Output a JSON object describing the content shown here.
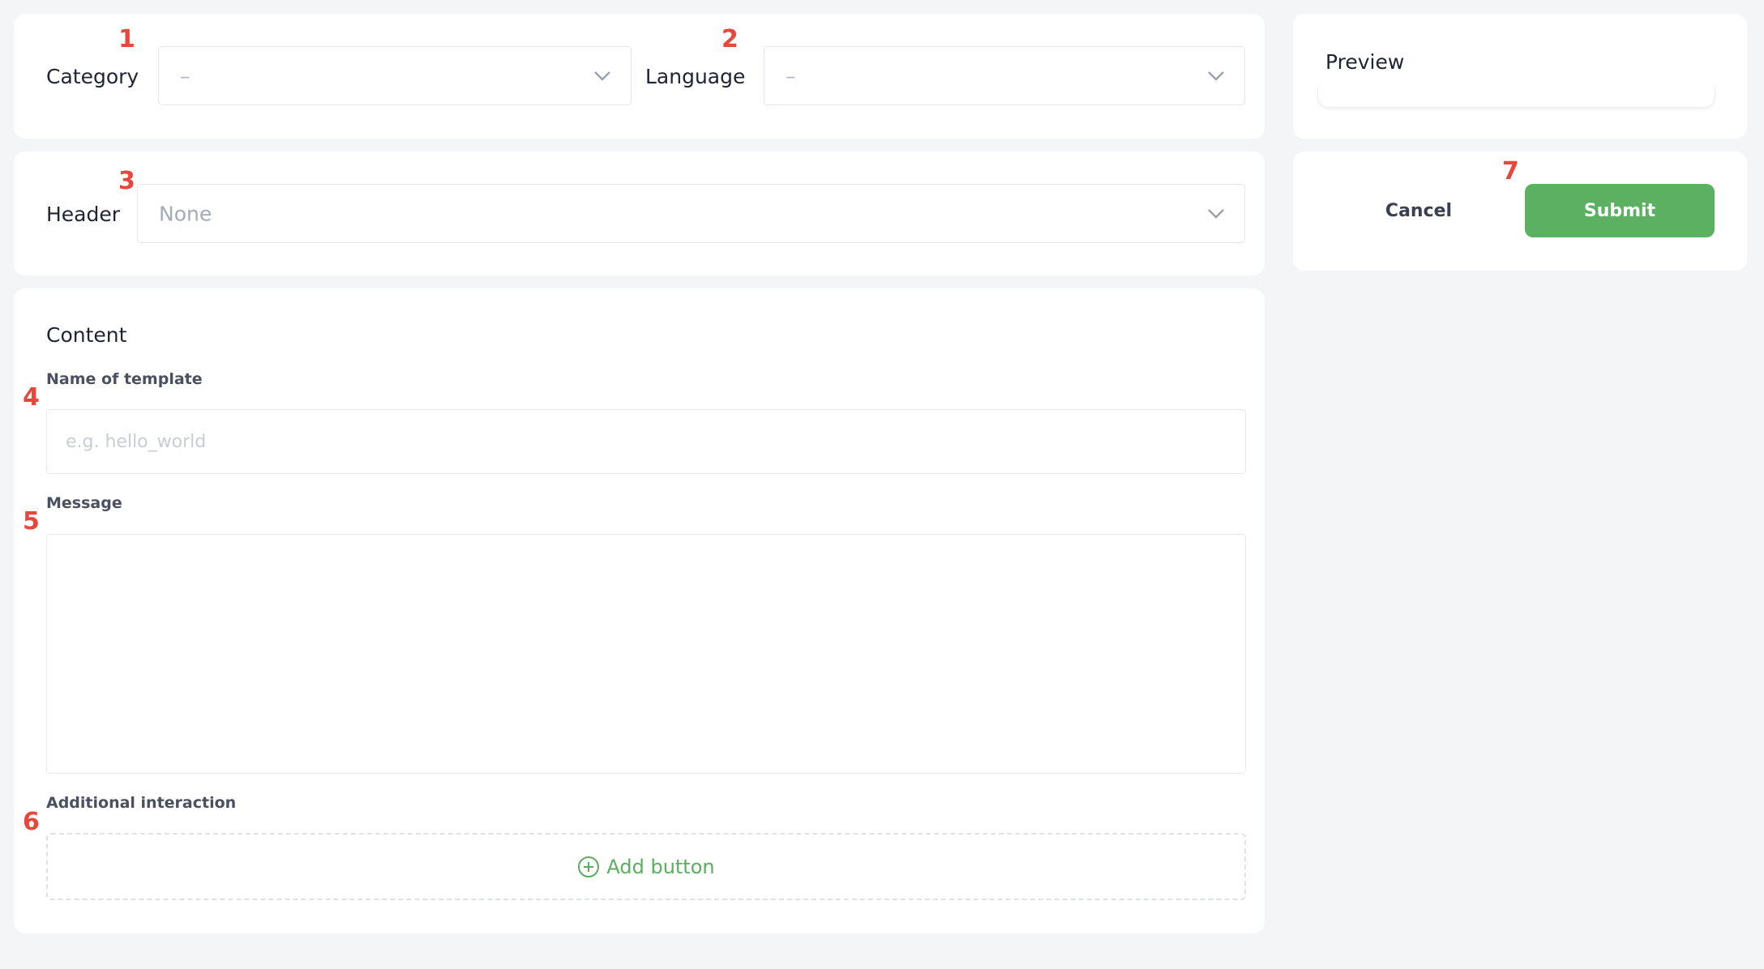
{
  "markers": [
    "1",
    "2",
    "3",
    "4",
    "5",
    "6",
    "7"
  ],
  "top_row": {
    "category": {
      "label": "Category",
      "value": "–"
    },
    "language": {
      "label": "Language",
      "value": "–"
    }
  },
  "header_row": {
    "label": "Header",
    "value": "None"
  },
  "content": {
    "title": "Content",
    "name_label": "Name of template",
    "name_placeholder": "e.g. hello_world",
    "message_label": "Message",
    "message_value": "",
    "interaction_label": "Additional interaction",
    "add_button_label": "Add button"
  },
  "preview": {
    "title": "Preview"
  },
  "actions": {
    "cancel_label": "Cancel",
    "submit_label": "Submit"
  },
  "colors": {
    "accent_green": "#5cb062",
    "marker_red": "#e8473b",
    "background": "#f4f5f7"
  },
  "icons": {
    "chevron": "chevron-down-icon",
    "add": "plus-circle-icon"
  }
}
